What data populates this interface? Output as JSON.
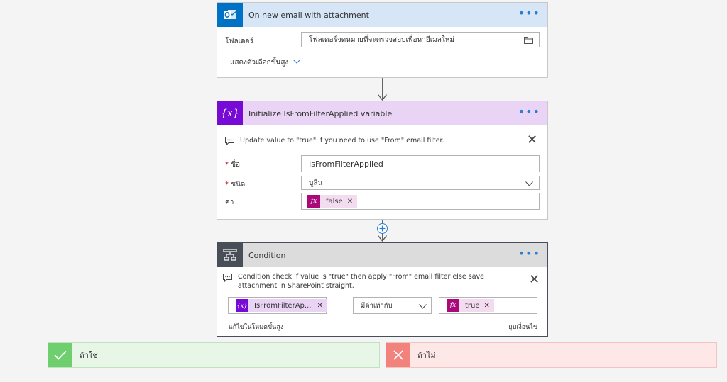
{
  "trigger": {
    "title": "On new email with attachment",
    "more": "•••",
    "folder_label": "โฟลเดอร์",
    "folder_value": "โฟลเดอร์จดหมายที่จะตรวจสอบเพื่อหาอีเมลใหม่",
    "advanced_link": "แสดงตัวเลือกขั้นสูง",
    "accent": "#0072c6",
    "header_bg": "#d6e6f7"
  },
  "init_var": {
    "title": "Initialize IsFromFilterApplied variable",
    "icon_text": "{x}",
    "more": "•••",
    "note": "Update value to \"true\" if you need to use \"From\" email filter.",
    "name_label": "ชื่อ",
    "name_value": "IsFromFilterApplied",
    "type_label": "ชนิด",
    "type_value": "บูลีน",
    "value_label": "ค่า",
    "value_token": "false",
    "accent": "#770bd6",
    "header_bg": "#ead4f6"
  },
  "condition": {
    "title": "Condition",
    "more": "•••",
    "note": "Condition check if value is \"true\" then apply \"From\" email filter else save attachment in SharePoint straight.",
    "left_token": "IsFromFilterAp...",
    "left_icon_text": "{x}",
    "operator": "มีค่าเท่ากับ",
    "right_token": "true",
    "edit_advanced": "แก้ไขในโหมดขั้นสูง",
    "collapse": "ยุบเงื่อนไข",
    "accent": "#484f58",
    "header_bg": "#dcdcdc"
  },
  "branches": {
    "yes_label": "ถ้าใช่",
    "no_label": "ถ้าไม่",
    "yes_color": "#6fcf6f",
    "no_color": "#f1827c"
  },
  "icons": {
    "outlook": "outlook-icon",
    "variable": "variable-icon",
    "condition": "condition-icon",
    "fx": "fx-icon",
    "folder": "folder-icon",
    "chevron": "chevron-down-icon",
    "comment": "comment-icon",
    "add": "add-step-icon",
    "check": "check-icon",
    "cross": "cross-icon"
  }
}
